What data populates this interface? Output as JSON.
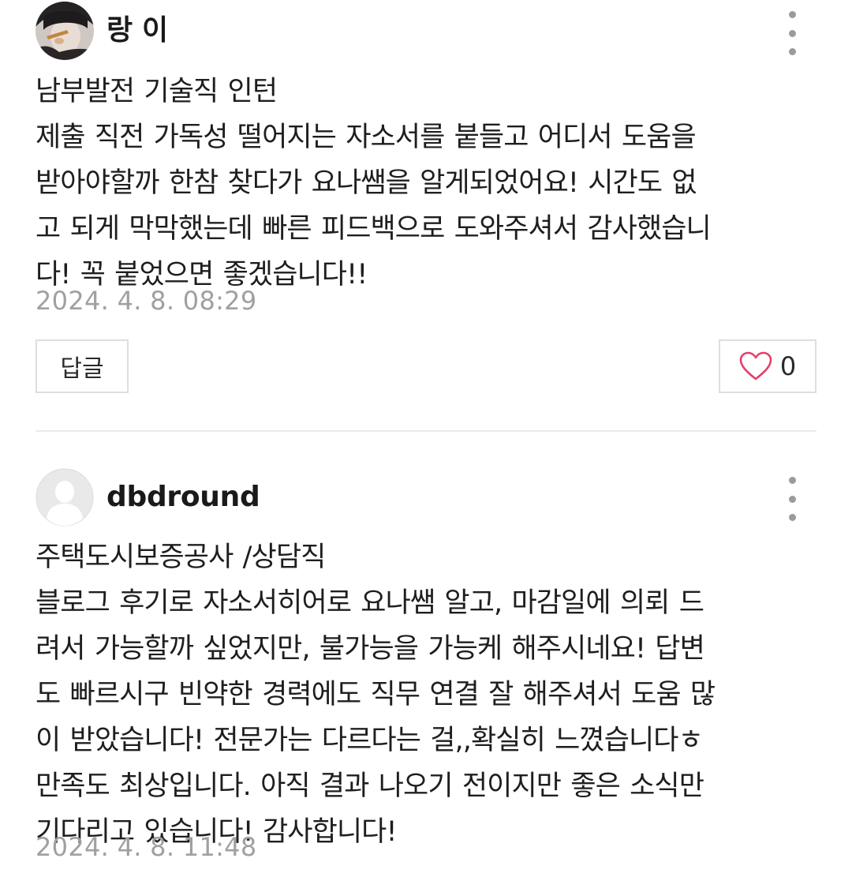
{
  "comments": [
    {
      "author": "랑 이",
      "lines": [
        "남부발전 기술직 인턴",
        "제출 직전 가독성 떨어지는 자소서를 붙들고 어디서 도움을",
        "받아야할까 한참 찾다가 요나쌤을 알게되었어요! 시간도 없",
        "고 되게 막막했는데 빠른 피드백으로 도와주셔서 감사했습니",
        "다!  꼭 붙었으면 좋겠습니다!!"
      ],
      "date": "2024. 4. 8. 08:29",
      "reply_label": "답글",
      "like_count": "0",
      "avatar_icon": "user-photo-icon"
    },
    {
      "author": "dbdround",
      "lines": [
        "주택도시보증공사 /상담직",
        "블로그 후기로 자소서히어로 요나쌤 알고, 마감일에 의뢰 드",
        "려서 가능할까 싶었지만, 불가능을 가능케 해주시네요! 답변",
        "도 빠르시구 빈약한 경력에도 직무 연결 잘 해주셔서 도움 많",
        "이 받았습니다! 전문가는 다르다는 걸,,확실히 느꼈습니다ㅎ",
        "만족도 최상입니다. 아직 결과 나오기 전이지만 좋은 소식만",
        "기다리고 있습니다! 감사합니다!"
      ],
      "date": "2024. 4. 8. 11:48",
      "avatar_icon": "default-avatar-icon"
    }
  ],
  "colors": {
    "text": "#1e1e1e",
    "muted": "#a0a0a0",
    "heart": "#e3406a",
    "border": "#dedede",
    "more_dots": "#9b9b9b"
  }
}
